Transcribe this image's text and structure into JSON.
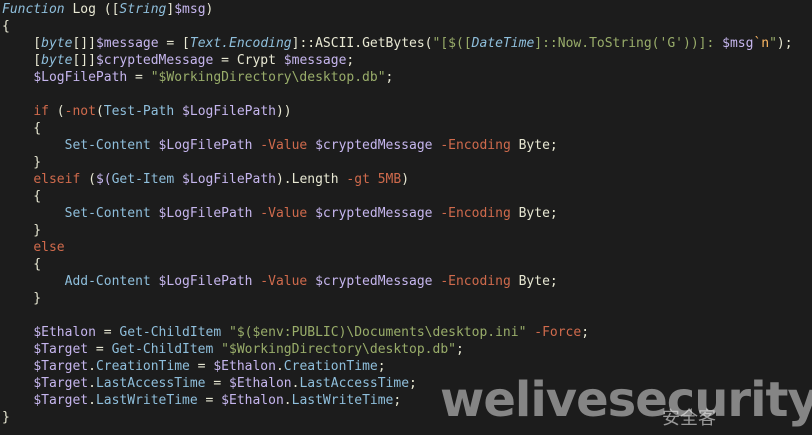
{
  "code": {
    "lines": [
      [
        {
          "t": "Function",
          "c": "kw"
        },
        {
          "t": " Log ",
          "c": "plain"
        },
        {
          "t": "([",
          "c": "bracket"
        },
        {
          "t": "String",
          "c": "type"
        },
        {
          "t": "]",
          "c": "bracket"
        },
        {
          "t": "$msg",
          "c": "var"
        },
        {
          "t": ")",
          "c": "bracket"
        }
      ],
      [
        {
          "t": "{",
          "c": "plain"
        }
      ],
      [
        {
          "t": "    [",
          "c": "plain"
        },
        {
          "t": "byte",
          "c": "type"
        },
        {
          "t": "[]]",
          "c": "plain"
        },
        {
          "t": "$message",
          "c": "var"
        },
        {
          "t": " = [",
          "c": "plain"
        },
        {
          "t": "Text.Encoding",
          "c": "type"
        },
        {
          "t": "]::ASCII.GetBytes(",
          "c": "plain"
        },
        {
          "t": "\"[$([",
          "c": "str"
        },
        {
          "t": "DateTime",
          "c": "type"
        },
        {
          "t": "]::Now.ToString('G'))]: ",
          "c": "str"
        },
        {
          "t": "$msg",
          "c": "var"
        },
        {
          "t": "`n",
          "c": "esc"
        },
        {
          "t": "\"",
          "c": "str"
        },
        {
          "t": ");",
          "c": "plain"
        }
      ],
      [
        {
          "t": "    [",
          "c": "plain"
        },
        {
          "t": "byte",
          "c": "type"
        },
        {
          "t": "[]]",
          "c": "plain"
        },
        {
          "t": "$cryptedMessage",
          "c": "var"
        },
        {
          "t": " = Crypt ",
          "c": "plain"
        },
        {
          "t": "$message",
          "c": "var"
        },
        {
          "t": ";",
          "c": "plain"
        }
      ],
      [
        {
          "t": "    ",
          "c": "plain"
        },
        {
          "t": "$LogFilePath",
          "c": "var"
        },
        {
          "t": " = ",
          "c": "plain"
        },
        {
          "t": "\"$WorkingDirectory\\desktop.db\"",
          "c": "str"
        },
        {
          "t": ";",
          "c": "plain"
        }
      ],
      [
        {
          "t": "",
          "c": "plain"
        }
      ],
      [
        {
          "t": "    ",
          "c": "plain"
        },
        {
          "t": "if",
          "c": "ctrl"
        },
        {
          "t": " (",
          "c": "plain"
        },
        {
          "t": "-not",
          "c": "op"
        },
        {
          "t": "(",
          "c": "plain"
        },
        {
          "t": "Test-Path",
          "c": "cmd"
        },
        {
          "t": " ",
          "c": "plain"
        },
        {
          "t": "$LogFilePath",
          "c": "var"
        },
        {
          "t": "))",
          "c": "plain"
        }
      ],
      [
        {
          "t": "    {",
          "c": "plain"
        }
      ],
      [
        {
          "t": "        ",
          "c": "plain"
        },
        {
          "t": "Set-Content",
          "c": "cmd"
        },
        {
          "t": " ",
          "c": "plain"
        },
        {
          "t": "$LogFilePath",
          "c": "var"
        },
        {
          "t": " ",
          "c": "plain"
        },
        {
          "t": "-Value",
          "c": "op"
        },
        {
          "t": " ",
          "c": "plain"
        },
        {
          "t": "$cryptedMessage",
          "c": "var"
        },
        {
          "t": " ",
          "c": "plain"
        },
        {
          "t": "-Encoding",
          "c": "op"
        },
        {
          "t": " Byte;",
          "c": "plain"
        }
      ],
      [
        {
          "t": "    }",
          "c": "plain"
        }
      ],
      [
        {
          "t": "    ",
          "c": "plain"
        },
        {
          "t": "elseif",
          "c": "ctrl"
        },
        {
          "t": " (",
          "c": "plain"
        },
        {
          "t": "$(",
          "c": "var"
        },
        {
          "t": "Get-Item",
          "c": "cmd"
        },
        {
          "t": " ",
          "c": "plain"
        },
        {
          "t": "$LogFilePath",
          "c": "var"
        },
        {
          "t": ").Length ",
          "c": "plain"
        },
        {
          "t": "-gt",
          "c": "op"
        },
        {
          "t": " ",
          "c": "plain"
        },
        {
          "t": "5MB",
          "c": "num"
        },
        {
          "t": ")",
          "c": "plain"
        }
      ],
      [
        {
          "t": "    {",
          "c": "plain"
        }
      ],
      [
        {
          "t": "        ",
          "c": "plain"
        },
        {
          "t": "Set-Content",
          "c": "cmd"
        },
        {
          "t": " ",
          "c": "plain"
        },
        {
          "t": "$LogFilePath",
          "c": "var"
        },
        {
          "t": " ",
          "c": "plain"
        },
        {
          "t": "-Value",
          "c": "op"
        },
        {
          "t": " ",
          "c": "plain"
        },
        {
          "t": "$cryptedMessage",
          "c": "var"
        },
        {
          "t": " ",
          "c": "plain"
        },
        {
          "t": "-Encoding",
          "c": "op"
        },
        {
          "t": " Byte;",
          "c": "plain"
        }
      ],
      [
        {
          "t": "    }",
          "c": "plain"
        }
      ],
      [
        {
          "t": "    ",
          "c": "plain"
        },
        {
          "t": "else",
          "c": "ctrl"
        }
      ],
      [
        {
          "t": "    {",
          "c": "plain"
        }
      ],
      [
        {
          "t": "        ",
          "c": "plain"
        },
        {
          "t": "Add-Content",
          "c": "cmd"
        },
        {
          "t": " ",
          "c": "plain"
        },
        {
          "t": "$LogFilePath",
          "c": "var"
        },
        {
          "t": " ",
          "c": "plain"
        },
        {
          "t": "-Value",
          "c": "op"
        },
        {
          "t": " ",
          "c": "plain"
        },
        {
          "t": "$cryptedMessage",
          "c": "var"
        },
        {
          "t": " ",
          "c": "plain"
        },
        {
          "t": "-Encoding",
          "c": "op"
        },
        {
          "t": " Byte;",
          "c": "plain"
        }
      ],
      [
        {
          "t": "    }",
          "c": "plain"
        }
      ],
      [
        {
          "t": "",
          "c": "plain"
        }
      ],
      [
        {
          "t": "    ",
          "c": "plain"
        },
        {
          "t": "$Ethalon",
          "c": "var"
        },
        {
          "t": " = ",
          "c": "plain"
        },
        {
          "t": "Get-ChildItem",
          "c": "cmd"
        },
        {
          "t": " ",
          "c": "plain"
        },
        {
          "t": "\"$($env:PUBLIC)\\Documents\\desktop.ini\"",
          "c": "str"
        },
        {
          "t": " ",
          "c": "plain"
        },
        {
          "t": "-Force",
          "c": "op"
        },
        {
          "t": ";",
          "c": "plain"
        }
      ],
      [
        {
          "t": "    ",
          "c": "plain"
        },
        {
          "t": "$Target",
          "c": "var"
        },
        {
          "t": " = ",
          "c": "plain"
        },
        {
          "t": "Get-ChildItem",
          "c": "cmd"
        },
        {
          "t": " ",
          "c": "plain"
        },
        {
          "t": "\"$WorkingDirectory\\desktop.db\"",
          "c": "str"
        },
        {
          "t": ";",
          "c": "plain"
        }
      ],
      [
        {
          "t": "    ",
          "c": "plain"
        },
        {
          "t": "$Target",
          "c": "var"
        },
        {
          "t": ".",
          "c": "plain"
        },
        {
          "t": "CreationTime",
          "c": "prop"
        },
        {
          "t": " = ",
          "c": "plain"
        },
        {
          "t": "$Ethalon",
          "c": "var"
        },
        {
          "t": ".",
          "c": "plain"
        },
        {
          "t": "CreationTime",
          "c": "prop"
        },
        {
          "t": ";",
          "c": "plain"
        }
      ],
      [
        {
          "t": "    ",
          "c": "plain"
        },
        {
          "t": "$Target",
          "c": "var"
        },
        {
          "t": ".",
          "c": "plain"
        },
        {
          "t": "LastAccessTime",
          "c": "prop"
        },
        {
          "t": " = ",
          "c": "plain"
        },
        {
          "t": "$Ethalon",
          "c": "var"
        },
        {
          "t": ".",
          "c": "plain"
        },
        {
          "t": "LastAccessTime",
          "c": "prop"
        },
        {
          "t": ";",
          "c": "plain"
        }
      ],
      [
        {
          "t": "    ",
          "c": "plain"
        },
        {
          "t": "$Target",
          "c": "var"
        },
        {
          "t": ".",
          "c": "plain"
        },
        {
          "t": "LastWriteTime",
          "c": "prop"
        },
        {
          "t": " = ",
          "c": "plain"
        },
        {
          "t": "$Ethalon",
          "c": "var"
        },
        {
          "t": ".",
          "c": "plain"
        },
        {
          "t": "LastWriteTime",
          "c": "prop"
        },
        {
          "t": ";",
          "c": "plain"
        }
      ],
      [
        {
          "t": "}",
          "c": "plain"
        }
      ]
    ]
  },
  "watermark": {
    "text": "welivesecurity",
    "subtext": "安全客"
  },
  "colors": {
    "background": "#1c1c1c",
    "keyword": "#8fbfdc",
    "variable": "#c6b6ee",
    "string": "#99ad6a",
    "operator": "#cf6a4c",
    "text": "#e8e8d3"
  }
}
